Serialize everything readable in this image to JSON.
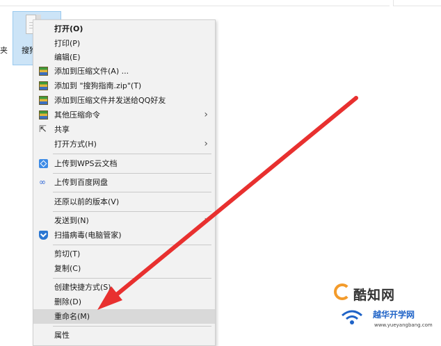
{
  "explorer": {
    "left_label": "夹",
    "file_name": "搜狗"
  },
  "menu": {
    "items": [
      {
        "label": "打开(O)",
        "bold": true
      },
      {
        "label": "打印(P)"
      },
      {
        "label": "编辑(E)"
      },
      {
        "label": "添加到压缩文件(A) ...",
        "icon": "zip-icon"
      },
      {
        "label": "添加到 \"搜狗指南.zip\"(T)",
        "icon": "zip-icon"
      },
      {
        "label": "添加到压缩文件并发送给QQ好友",
        "icon": "zip-icon"
      },
      {
        "label": "其他压缩命令",
        "icon": "zip-icon",
        "submenu": true
      },
      {
        "label": "共享",
        "icon": "share-icon"
      },
      {
        "label": "打开方式(H)",
        "submenu": true
      },
      {
        "label": "上传到WPS云文档",
        "icon": "wps-cloud-icon"
      },
      {
        "label": "上传到百度网盘",
        "icon": "baidu-netdisk-icon"
      },
      {
        "label": "还原以前的版本(V)"
      },
      {
        "label": "发送到(N)",
        "submenu": true
      },
      {
        "label": "扫描病毒(电脑管家)",
        "icon": "shield-icon"
      },
      {
        "label": "剪切(T)"
      },
      {
        "label": "复制(C)"
      },
      {
        "label": "创建快捷方式(S)"
      },
      {
        "label": "删除(D)"
      },
      {
        "label": "重命名(M)",
        "highlighted": true
      },
      {
        "label": "属性"
      }
    ]
  },
  "watermark": {
    "brand": "酷知网",
    "brand2": "越华开学网",
    "url": "www.yueyangbang.com"
  },
  "colors": {
    "arrow": "#e8302f",
    "highlight": "#d9d9d9",
    "menu_bg": "#f2f2f2",
    "selection": "#cce4f7"
  }
}
